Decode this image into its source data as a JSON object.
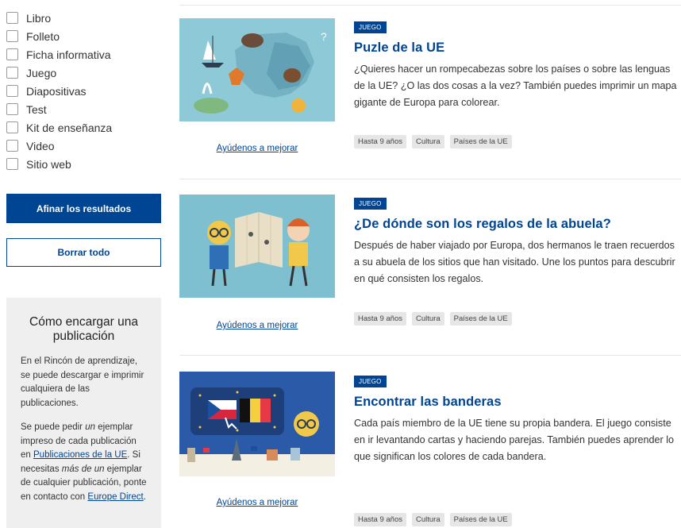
{
  "filters": {
    "items": [
      {
        "label": "Libro",
        "name": "libro"
      },
      {
        "label": "Folleto",
        "name": "folleto"
      },
      {
        "label": "Ficha informativa",
        "name": "ficha-informativa"
      },
      {
        "label": "Juego",
        "name": "juego"
      },
      {
        "label": "Diapositivas",
        "name": "diapositivas"
      },
      {
        "label": "Test",
        "name": "test"
      },
      {
        "label": "Kit de enseñanza",
        "name": "kit-de-ensenanza"
      },
      {
        "label": "Video",
        "name": "video"
      },
      {
        "label": "Sitio web",
        "name": "sitio-web"
      }
    ],
    "refine_label": "Afinar los resultados",
    "clear_label": "Borrar todo"
  },
  "order_box": {
    "title": "Cómo encargar una publicación",
    "p1": "En el Rincón de aprendizaje, se puede descargar e imprimir cualquiera de las publicaciones.",
    "p2_a": "Se puede pedir ",
    "p2_em1": "un",
    "p2_b": " ejemplar impreso de cada publicación en ",
    "p2_link1": "Publicaciones de la UE",
    "p2_c": ". Si necesitas ",
    "p2_em2": "más de un",
    "p2_d": " ejemplar de cualquier publicación, ponte en contacto con ",
    "p2_link2": "Europe Direct",
    "p2_e": "."
  },
  "results": [
    {
      "type": "JUEGO",
      "title": "Puzle de la UE",
      "description": "¿Quieres hacer un rompecabezas sobre los países o sobre las lenguas de la UE? ¿O las dos cosas a la vez? También puedes imprimir un mapa gigante de Europa para colorear.",
      "help_link": "Ayúdenos a mejorar",
      "tags": [
        "Hasta 9 años",
        "Cultura",
        "Países de la UE"
      ]
    },
    {
      "type": "JUEGO",
      "title": "¿De dónde son los regalos de la abuela?",
      "description": "Después de haber viajado por Europa, dos hermanos le traen recuerdos a su abuela de los sitios que han visitado. Une los puntos para descubrir en qué consisten los regalos.",
      "help_link": "Ayúdenos a mejorar",
      "tags": [
        "Hasta 9 años",
        "Cultura",
        "Países de la UE"
      ]
    },
    {
      "type": "JUEGO",
      "title": "Encontrar las banderas",
      "description": "Cada país miembro de la UE tiene su propia bandera. El juego consiste en ir levantando cartas y haciendo parejas. También puedes aprender lo que significan los colores de cada bandera.",
      "help_link": "Ayúdenos a mejorar",
      "tags": [
        "Hasta 9 años",
        "Cultura",
        "Países de la UE"
      ]
    }
  ],
  "colors": {
    "accent": "#004494",
    "tag_bg": "#e6e6e6",
    "sidebar_box_bg": "#efefef",
    "thumb_bg_blue": "#8ec9d8"
  }
}
